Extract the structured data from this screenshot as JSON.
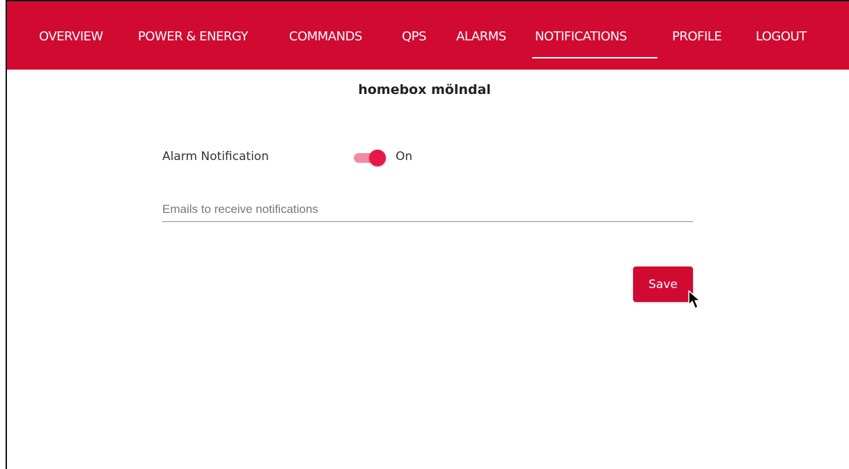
{
  "nav": {
    "items": [
      {
        "label": "OVERVIEW"
      },
      {
        "label": "POWER & ENERGY"
      },
      {
        "label": "COMMANDS"
      },
      {
        "label": "QPS"
      },
      {
        "label": "ALARMS"
      },
      {
        "label": "NOTIFICATIONS",
        "active": true
      },
      {
        "label": "PROFILE"
      },
      {
        "label": "LOGOUT"
      }
    ]
  },
  "page": {
    "title": "homebox mölndal"
  },
  "form": {
    "alarm_label": "Alarm Notification",
    "alarm_toggle_on": true,
    "alarm_state_text": "On",
    "emails_placeholder": "Emails to receive notifications",
    "emails_value": "",
    "save_label": "Save"
  },
  "colors": {
    "brand": "#d10a32",
    "toggle_knob": "#e8174a",
    "toggle_track": "#f48aa0"
  }
}
